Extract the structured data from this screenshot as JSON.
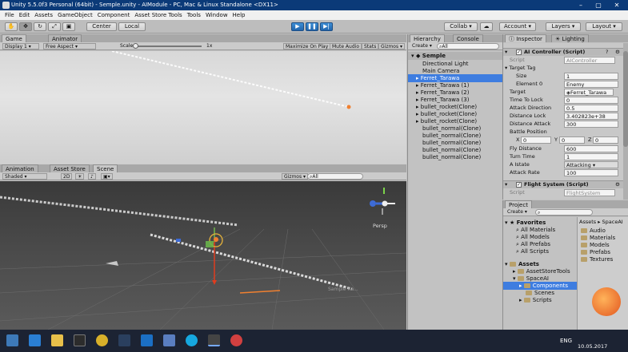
{
  "window": {
    "title": "Unity 5.5.0f3 Personal (64bit) - Semple.unity - AIModule - PC, Mac & Linux Standalone <DX11>"
  },
  "menu": [
    "File",
    "Edit",
    "Assets",
    "GameObject",
    "Component",
    "Asset Store Tools",
    "Tools",
    "Window",
    "Help"
  ],
  "toolbar": {
    "center": "Center",
    "local": "Local",
    "collab": "Collab ▾",
    "account": "Account",
    "layers": "Layers",
    "layout": "Layout"
  },
  "game": {
    "tab": "Game",
    "tab2": "Animator",
    "display": "Display 1",
    "aspect": "Free Aspect",
    "scale_label": "Scale",
    "scale_value": "1x",
    "maximize": "Maximize On Play",
    "mute": "Mute Audio",
    "stats": "Stats",
    "gizmos": "Gizmos ▾"
  },
  "scene": {
    "tabs": [
      "Animation",
      "Asset Store",
      "Scene"
    ],
    "shaded": "Shaded",
    "mode2d": "2D",
    "gizmos": "Gizmos ▾",
    "search": "All",
    "persp": "Persp",
    "watermark": "Sample Ra..."
  },
  "hierarchy": {
    "tab": "Hierarchy",
    "tab2": "Console",
    "create": "Create ▾",
    "search": "All",
    "scene": "Semple",
    "items": [
      "Directional Light",
      "Main Camera",
      "Ferret_Tarawa",
      "Ferret_Tarawa (1)",
      "Ferret_Tarawa (2)",
      "Ferret_Tarawa (3)",
      "bullet_rocket(Clone)",
      "bullet_rocket(Clone)",
      "bullet_rocket(Clone)",
      "bullet_normal(Clone)",
      "bullet_normal(Clone)",
      "bullet_normal(Clone)",
      "bullet_normal(Clone)",
      "bullet_normal(Clone)"
    ]
  },
  "inspector": {
    "tab": "Inspector",
    "tab2": "Lighting",
    "comp1": {
      "title": "AI Controller (Script)",
      "script_label": "Script",
      "script_value": "AIController",
      "target_tag": "Target Tag",
      "size_label": "Size",
      "size_value": "1",
      "el0_label": "Element 0",
      "el0_value": "Enemy",
      "target_label": "Target",
      "target_value": "Ferret_Tarawa",
      "ttl_label": "Time To Lock",
      "ttl_value": "0",
      "ad_label": "Attack Direction",
      "ad_value": "0.5",
      "dl_label": "Distance Lock",
      "dl_value": "3.402823e+38",
      "da_label": "Distance Attack",
      "da_value": "300",
      "bp_label": "Battle Position",
      "x": "0",
      "y": "0",
      "z": "0",
      "fd_label": "Fly Distance",
      "fd_value": "600",
      "tt_label": "Turn Time",
      "tt_value": "1",
      "ai_label": "A Istate",
      "ai_value": "Attacking",
      "ar_label": "Attack Rate",
      "ar_value": "100"
    },
    "comp2": {
      "title": "Flight System (Script)",
      "script_label": "Script",
      "script_value": "FlightSystem"
    }
  },
  "project": {
    "tab": "Project",
    "create": "Create ▾",
    "favorites": "Favorites",
    "fav_items": [
      "All Materials",
      "All Models",
      "All Prefabs",
      "All Scripts"
    ],
    "assets": "Assets",
    "tree": [
      "AssetStoreTools",
      "SpaceAI",
      "Components",
      "Scenes",
      "Scripts"
    ],
    "breadcrumb": "Assets ▸ SpaceAI",
    "folders": [
      "Audio",
      "Materials",
      "Models",
      "Prefabs",
      "Textures"
    ]
  },
  "taskbar": {
    "lang": "ENG",
    "time": "10.05.2017"
  },
  "colors": {
    "accent": "#3d79b8",
    "selection": "#3e7de0",
    "titlebar": "#0b3a78"
  }
}
